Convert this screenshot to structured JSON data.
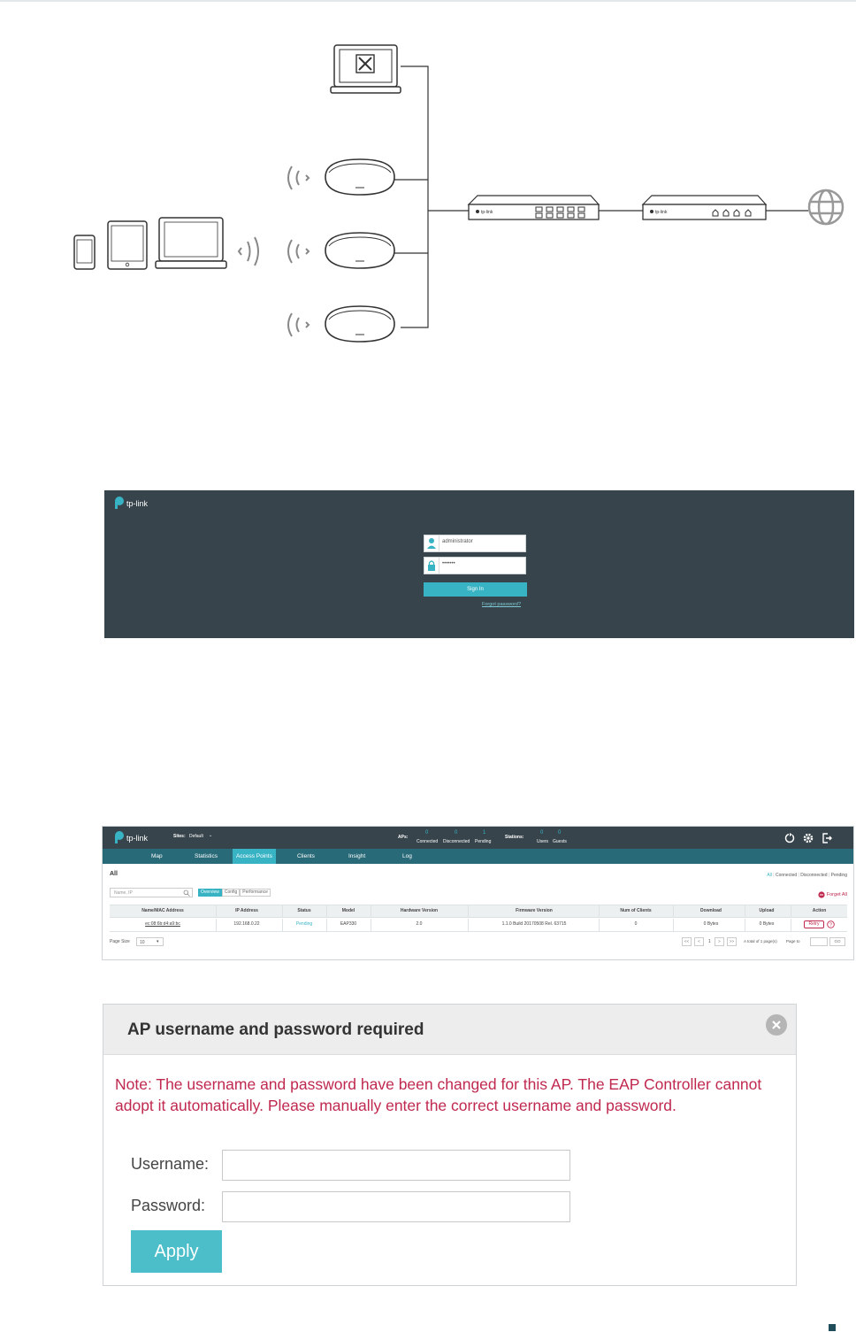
{
  "colors": {
    "accent": "#38b3c4",
    "dark_header": "#37444b",
    "nav_bar": "#296a78",
    "note_red": "#c0294f",
    "apply_button": "#4cbec9"
  },
  "diagram": {
    "device_brand": "tp-link"
  },
  "login": {
    "brand": "tp-link",
    "username_value": "administrator",
    "password_value": "•••••••",
    "signin_label": "Sign In",
    "forgot_label": "Forgot password?"
  },
  "controller": {
    "brand": "tp-link",
    "sites_label": "Sites:",
    "sites_value": "Default",
    "aps_label": "APs:",
    "aps": [
      {
        "count": "0",
        "label": "Connected"
      },
      {
        "count": "0",
        "label": "Disconnected"
      },
      {
        "count": "1",
        "label": "Pending"
      }
    ],
    "stations_label": "Stations:",
    "stations": [
      {
        "count": "0",
        "label": "Users"
      },
      {
        "count": "0",
        "label": "Guests"
      }
    ],
    "nav": [
      "Map",
      "Statistics",
      "Access Points",
      "Clients",
      "Insight",
      "Log"
    ],
    "section_title": "All",
    "filters": [
      "All",
      "Connected",
      "Disconnected",
      "Pending"
    ],
    "search_placeholder": "Name, IP",
    "view_tabs": [
      "Overview",
      "Config",
      "Performance"
    ],
    "forget_all_label": "Forget All",
    "columns": [
      "Name/MAC Address",
      "IP Address",
      "Status",
      "Model",
      "Hardware Version",
      "Firmware Version",
      "Num of Clients",
      "Download",
      "Upload",
      "Action"
    ],
    "rows": [
      [
        "ec:08:6b:d4:a9:bc",
        "192.168.0.22",
        "Pending",
        "EAP330",
        "2.0",
        "1.1.0 Build 20170508 Rel. 63715",
        "0",
        "0 Bytes",
        "0 Bytes"
      ]
    ],
    "retry_label": "Retry",
    "page_size_label": "Page Size",
    "page_size_value": "10",
    "pager": [
      "<<",
      "<",
      "1",
      ">",
      ">>"
    ],
    "total_label": "A total of 1 page(s)",
    "page_to_label": "Page to",
    "go_label": "GO"
  },
  "modal": {
    "title": "AP username and password required",
    "note": "Note: The username and password have been changed for this AP. The EAP Controller cannot adopt it automatically. Please manually enter the correct username and password.",
    "username_label": "Username:",
    "username_value": "",
    "password_label": "Password:",
    "password_value": "",
    "apply_label": "Apply"
  }
}
